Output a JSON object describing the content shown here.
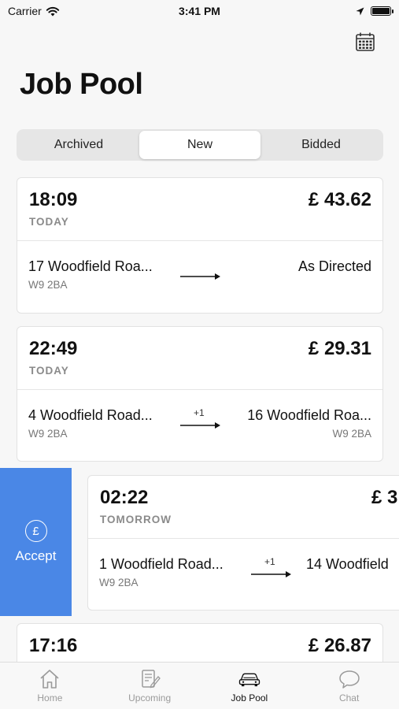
{
  "status": {
    "carrier": "Carrier",
    "time": "3:41 PM"
  },
  "header": {
    "title": "Job Pool",
    "calendar_icon": "calendar-icon"
  },
  "segments": [
    {
      "label": "Archived",
      "active": false
    },
    {
      "label": "New",
      "active": true
    },
    {
      "label": "Bidded",
      "active": false
    }
  ],
  "jobs": [
    {
      "time": "18:09",
      "day": "TODAY",
      "price": "£ 43.62",
      "from": "17 Woodfield Roa...",
      "from_postcode": "W9 2BA",
      "stops": "",
      "to": "As Directed",
      "to_postcode": ""
    },
    {
      "time": "22:49",
      "day": "TODAY",
      "price": "£ 29.31",
      "from": "4 Woodfield Road...",
      "from_postcode": "W9 2BA",
      "stops": "+1",
      "to": "16 Woodfield Roa...",
      "to_postcode": "W9 2BA"
    },
    {
      "time": "02:22",
      "day": "TOMORROW",
      "price": "£ 3",
      "from": "1 Woodfield Road...",
      "from_postcode": "W9 2BA",
      "stops": "+1",
      "to": "14 Woodfield",
      "to_postcode": ""
    },
    {
      "time": "17:16",
      "day": "",
      "price": "£ 26.87"
    }
  ],
  "swipe_action": {
    "label": "Accept",
    "icon": "pound-circle-icon",
    "color": "#4a87e6"
  },
  "tabbar": [
    {
      "label": "Home",
      "icon": "home-icon",
      "active": false
    },
    {
      "label": "Upcoming",
      "icon": "notepad-icon",
      "active": false
    },
    {
      "label": "Job Pool",
      "icon": "car-icon",
      "active": true
    },
    {
      "label": "Chat",
      "icon": "chat-bubble-icon",
      "active": false
    }
  ]
}
